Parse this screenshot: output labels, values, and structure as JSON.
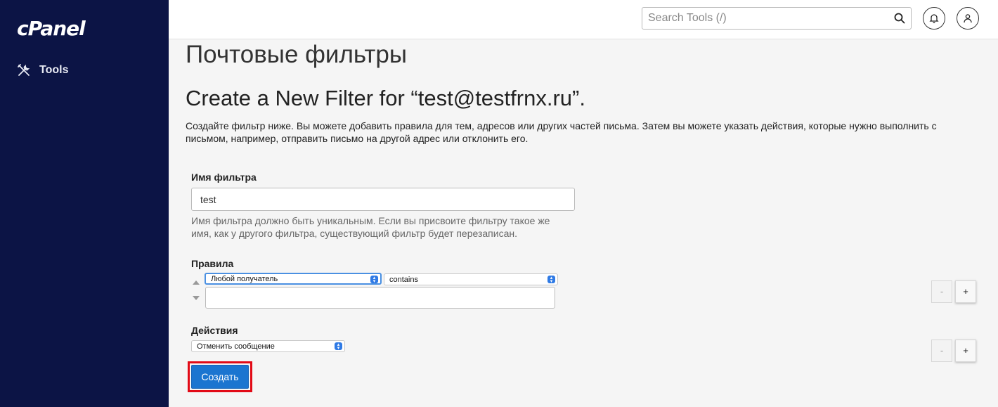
{
  "sidebar": {
    "logo": "cPanel",
    "items": [
      {
        "label": "Tools",
        "icon": "tools-icon"
      }
    ]
  },
  "header": {
    "search_placeholder": "Search Tools (/)",
    "icons": [
      "search-icon",
      "bell-icon",
      "user-icon"
    ]
  },
  "page": {
    "title": "Почтовые фильтры",
    "subtitle": "Create a New Filter for “test@testfrnx.ru”.",
    "intro": "Создайте фильтр ниже. Вы можете добавить правила для тем, адресов или других частей письма. Затем вы можете указать действия, которые нужно выполнить с письмом, например, отправить письмо на другой адрес или отклонить его."
  },
  "filter_name": {
    "label": "Имя фильтра",
    "value": "test",
    "help": "Имя фильтра должно быть уникальным. Если вы присвоите фильтру такое же имя, как у другого фильтра, существующий фильтр будет перезаписан."
  },
  "rules": {
    "label": "Правила",
    "field_selected": "Любой получатель",
    "operator_selected": "contains",
    "value": "",
    "minus_label": "-",
    "plus_label": "+"
  },
  "actions": {
    "label": "Действия",
    "action_selected": "Отменить сообщение",
    "minus_label": "-",
    "plus_label": "+"
  },
  "submit": {
    "label": "Создать"
  },
  "colors": {
    "sidebar_bg": "#0c1445",
    "primary_button": "#1b75d0",
    "highlight_border": "#e20a16",
    "select_caret": "#2f7ae5"
  }
}
